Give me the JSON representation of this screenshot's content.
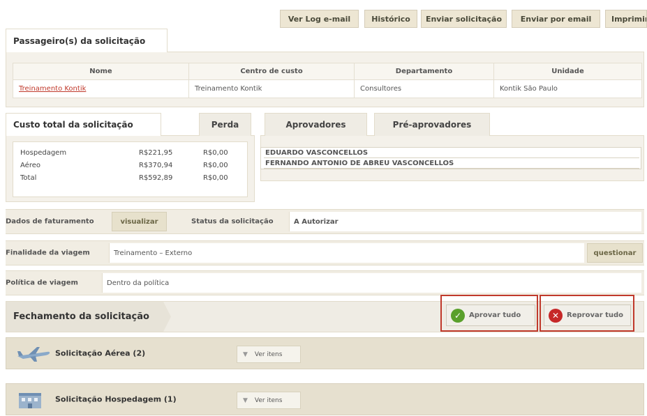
{
  "top_buttons": [
    "Ver Log e-mail",
    "Histórico",
    "Enviar solicitação",
    "Enviar por email",
    "Imprimir"
  ],
  "passenger_tab": "Passageiro(s) da solicitação",
  "passenger_table": {
    "headers": [
      "Nome",
      "Centro de custo",
      "Departamento",
      "Unidade"
    ],
    "row": [
      "Treinamento Kontik",
      "Treinamento Kontik",
      "Consultores",
      "Kontik São Paulo"
    ]
  },
  "cost": {
    "tab": "Custo total da solicitação",
    "loss_tab": "Perda",
    "rows": [
      {
        "label": "Hospedagem",
        "value": "R$221,95",
        "loss": "R$0,00"
      },
      {
        "label": "Aéreo",
        "value": "R$370,94",
        "loss": "R$0,00"
      },
      {
        "label": "Total",
        "value": "R$592,89",
        "loss": "R$0,00"
      }
    ]
  },
  "approvers": {
    "tab": "Aprovadores",
    "pre_tab": "Pré-aprovadores",
    "names": [
      "EDUARDO VASCONCELLOS",
      "FERNANDO ANTONIO DE ABREU VASCONCELLOS"
    ]
  },
  "billing": {
    "label": "Dados de faturamento",
    "button": "visualizar",
    "status_label": "Status da solicitação",
    "status_value": "A Autorizar"
  },
  "purpose": {
    "label": "Finalidade da viagem",
    "value": "Treinamento – Externo",
    "button": "questionar"
  },
  "policy": {
    "label": "Política de viagem",
    "value": "Dentro da política"
  },
  "closing": {
    "title": "Fechamento da solicitação",
    "approve": "Aprovar tudo",
    "reject": "Reprovar tudo"
  },
  "sections": [
    {
      "title": "Solicitação Aérea (2)",
      "button": "Ver itens"
    },
    {
      "title": "Solicitação Hospedagem (1)",
      "button": "Ver itens"
    }
  ]
}
